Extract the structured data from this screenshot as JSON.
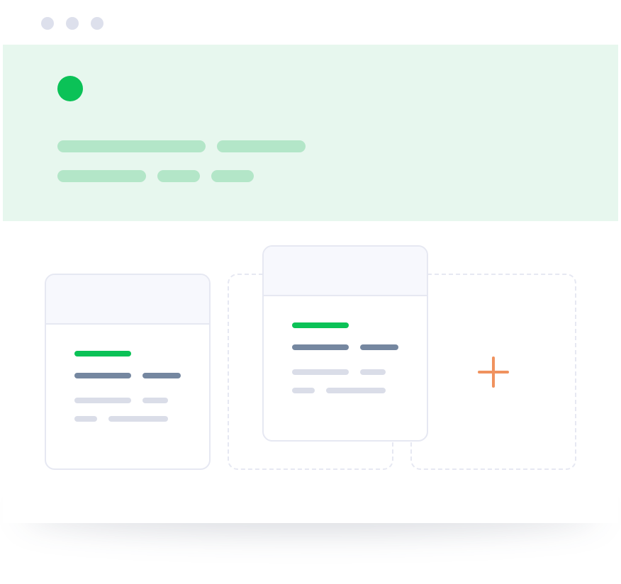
{
  "window": {
    "controls": [
      "close",
      "minimize",
      "maximize"
    ]
  },
  "hero": {
    "avatar_color": "#0bc257",
    "background_color": "#e7f7ee"
  },
  "cards": {
    "accent_color": "#0bc257",
    "add_icon": "plus-icon",
    "add_icon_color": "#f0925e"
  }
}
